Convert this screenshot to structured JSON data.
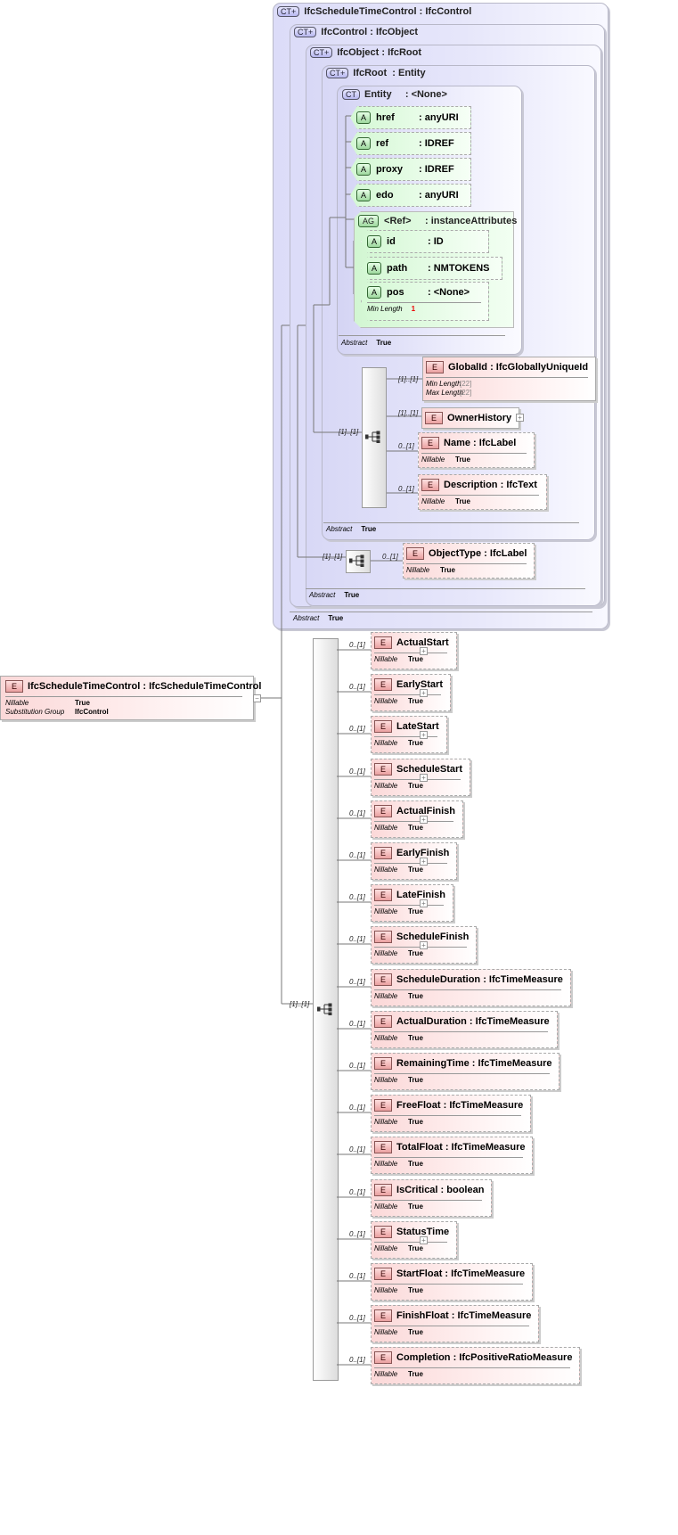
{
  "root_element": {
    "badge": "E",
    "name": "IfcScheduleTimeControl",
    "type": ": IfcScheduleTimeControl",
    "props": [
      {
        "label": "Nillable",
        "value": "True"
      },
      {
        "label": "Substitution Group",
        "value": "IfcControl"
      }
    ],
    "toggle": "−"
  },
  "types": [
    {
      "badge": "CT+",
      "name": "IfcScheduleTimeControl",
      "base": ": IfcControl",
      "abstract_label": "Abstract",
      "abstract_value": "True"
    },
    {
      "badge": "CT+",
      "name": "IfcControl",
      "base": ": IfcObject",
      "abstract_label": "Abstract",
      "abstract_value": "True"
    },
    {
      "badge": "CT+",
      "name": "IfcObject",
      "base": ": IfcRoot",
      "abstract_label": "Abstract",
      "abstract_value": "True"
    },
    {
      "badge": "CT+",
      "name": "IfcRoot",
      "base": ": Entity",
      "abstract_label": "Abstract",
      "abstract_value": "True"
    },
    {
      "badge": "CT",
      "name": "Entity",
      "base": ": <None>",
      "abstract_label": "Abstract",
      "abstract_value": "True"
    }
  ],
  "attributes": [
    {
      "badge": "A",
      "name": "href",
      "type": ": anyURI"
    },
    {
      "badge": "A",
      "name": "ref",
      "type": ": IDREF"
    },
    {
      "badge": "A",
      "name": "proxy",
      "type": ": IDREF"
    },
    {
      "badge": "A",
      "name": "edo",
      "type": ": anyURI"
    }
  ],
  "attribute_group": {
    "badge": "AG",
    "name": "<Ref>",
    "type": ": instanceAttributes",
    "attributes": [
      {
        "badge": "A",
        "name": "id",
        "type": ": ID"
      },
      {
        "badge": "A",
        "name": "path",
        "type": ": NMTOKENS"
      },
      {
        "badge": "A",
        "name": "pos",
        "type": ": <None>",
        "prop_label": "Min Length",
        "prop_value": "1"
      }
    ]
  },
  "root_sequence": {
    "cardinality": "[1]..[1]",
    "elements": [
      {
        "card": "[1]..[1]",
        "name": "GlobalId",
        "type": ": IfcGloballyUniqueId",
        "props": [
          {
            "label": "Min Length",
            "value": "[22]"
          },
          {
            "label": "Max Length",
            "value": "[22]"
          }
        ]
      },
      {
        "card": "[1]..[1]",
        "name": "OwnerHistory",
        "type": "",
        "toggle": "+"
      },
      {
        "card": "0..[1]",
        "name": "Name",
        "type": ": IfcLabel",
        "props": [
          {
            "label": "Nillable",
            "value": "True"
          }
        ]
      },
      {
        "card": "0..[1]",
        "name": "Description",
        "type": ": IfcText",
        "props": [
          {
            "label": "Nillable",
            "value": "True"
          }
        ]
      }
    ]
  },
  "object_sequence": {
    "cardinality": "[1]..[1]",
    "elements": [
      {
        "card": "0..[1]",
        "name": "ObjectType",
        "type": ": IfcLabel",
        "props": [
          {
            "label": "Nillable",
            "value": "True"
          }
        ]
      }
    ]
  },
  "main_sequence": {
    "cardinality": "[1]..[1]",
    "elements": [
      {
        "card": "0..[1]",
        "name": "ActualStart",
        "type": "",
        "nillable": "True",
        "toggle": "+"
      },
      {
        "card": "0..[1]",
        "name": "EarlyStart",
        "type": "",
        "nillable": "True",
        "toggle": "+"
      },
      {
        "card": "0..[1]",
        "name": "LateStart",
        "type": "",
        "nillable": "True",
        "toggle": "+"
      },
      {
        "card": "0..[1]",
        "name": "ScheduleStart",
        "type": "",
        "nillable": "True",
        "toggle": "+"
      },
      {
        "card": "0..[1]",
        "name": "ActualFinish",
        "type": "",
        "nillable": "True",
        "toggle": "+"
      },
      {
        "card": "0..[1]",
        "name": "EarlyFinish",
        "type": "",
        "nillable": "True",
        "toggle": "+"
      },
      {
        "card": "0..[1]",
        "name": "LateFinish",
        "type": "",
        "nillable": "True",
        "toggle": "+"
      },
      {
        "card": "0..[1]",
        "name": "ScheduleFinish",
        "type": "",
        "nillable": "True",
        "toggle": "+"
      },
      {
        "card": "0..[1]",
        "name": "ScheduleDuration",
        "type": ": IfcTimeMeasure",
        "nillable": "True"
      },
      {
        "card": "0..[1]",
        "name": "ActualDuration",
        "type": ": IfcTimeMeasure",
        "nillable": "True"
      },
      {
        "card": "0..[1]",
        "name": "RemainingTime",
        "type": ": IfcTimeMeasure",
        "nillable": "True"
      },
      {
        "card": "0..[1]",
        "name": "FreeFloat",
        "type": ": IfcTimeMeasure",
        "nillable": "True"
      },
      {
        "card": "0..[1]",
        "name": "TotalFloat",
        "type": ": IfcTimeMeasure",
        "nillable": "True"
      },
      {
        "card": "0..[1]",
        "name": "IsCritical",
        "type": ": boolean",
        "nillable": "True"
      },
      {
        "card": "0..[1]",
        "name": "StatusTime",
        "type": "",
        "nillable": "True",
        "toggle": "+"
      },
      {
        "card": "0..[1]",
        "name": "StartFloat",
        "type": ": IfcTimeMeasure",
        "nillable": "True"
      },
      {
        "card": "0..[1]",
        "name": "FinishFloat",
        "type": ": IfcTimeMeasure",
        "nillable": "True"
      },
      {
        "card": "0..[1]",
        "name": "Completion",
        "type": ": IfcPositiveRatioMeasure",
        "nillable": "True"
      }
    ],
    "nillable_label": "Nillable"
  }
}
